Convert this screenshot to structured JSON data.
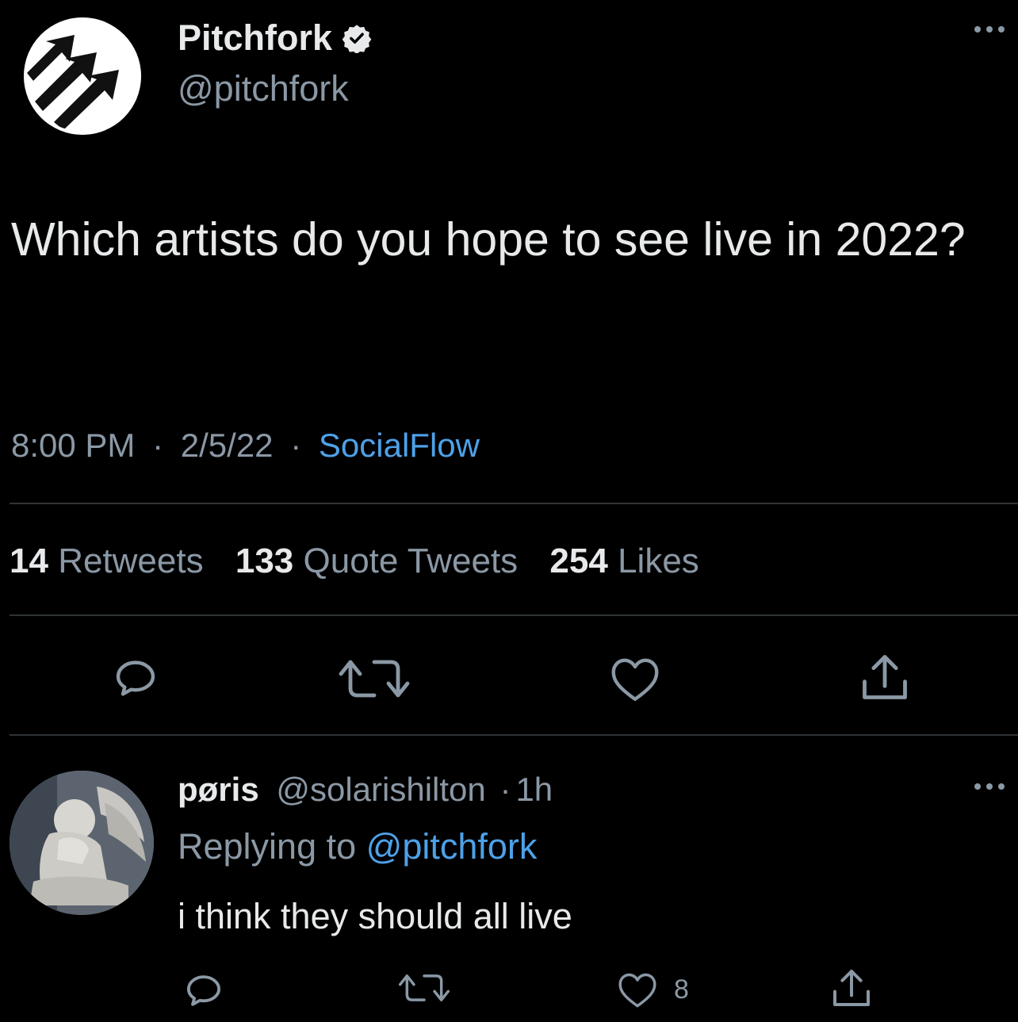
{
  "main_tweet": {
    "author_name": "Pitchfork",
    "author_handle": "@pitchfork",
    "verified_icon": "verified-badge-icon",
    "text": "Which artists do you hope to see live in 2022?",
    "time": "8:00 PM",
    "separator": "·",
    "date": "2/5/22",
    "source": "SocialFlow",
    "stats": {
      "retweets_count": "14",
      "retweets_label": "Retweets",
      "quotes_count": "133",
      "quotes_label": "Quote Tweets",
      "likes_count": "254",
      "likes_label": "Likes"
    },
    "actions": [
      "reply-icon",
      "retweet-icon",
      "like-icon",
      "share-icon"
    ]
  },
  "reply": {
    "author_name": "pøris",
    "author_handle": "@solarishilton",
    "separator": "·",
    "age": "1h",
    "replying_label": "Replying to",
    "replying_handle": "@pitchfork",
    "text": "i think they should all live",
    "like_count": "8",
    "actions": [
      "reply-icon",
      "retweet-icon",
      "like-icon",
      "share-icon"
    ]
  },
  "colors": {
    "background": "#000000",
    "primary_text": "#e7e9ea",
    "secondary_text": "#8b98a5",
    "link": "#4ea1e8",
    "divider": "#2f3336"
  }
}
